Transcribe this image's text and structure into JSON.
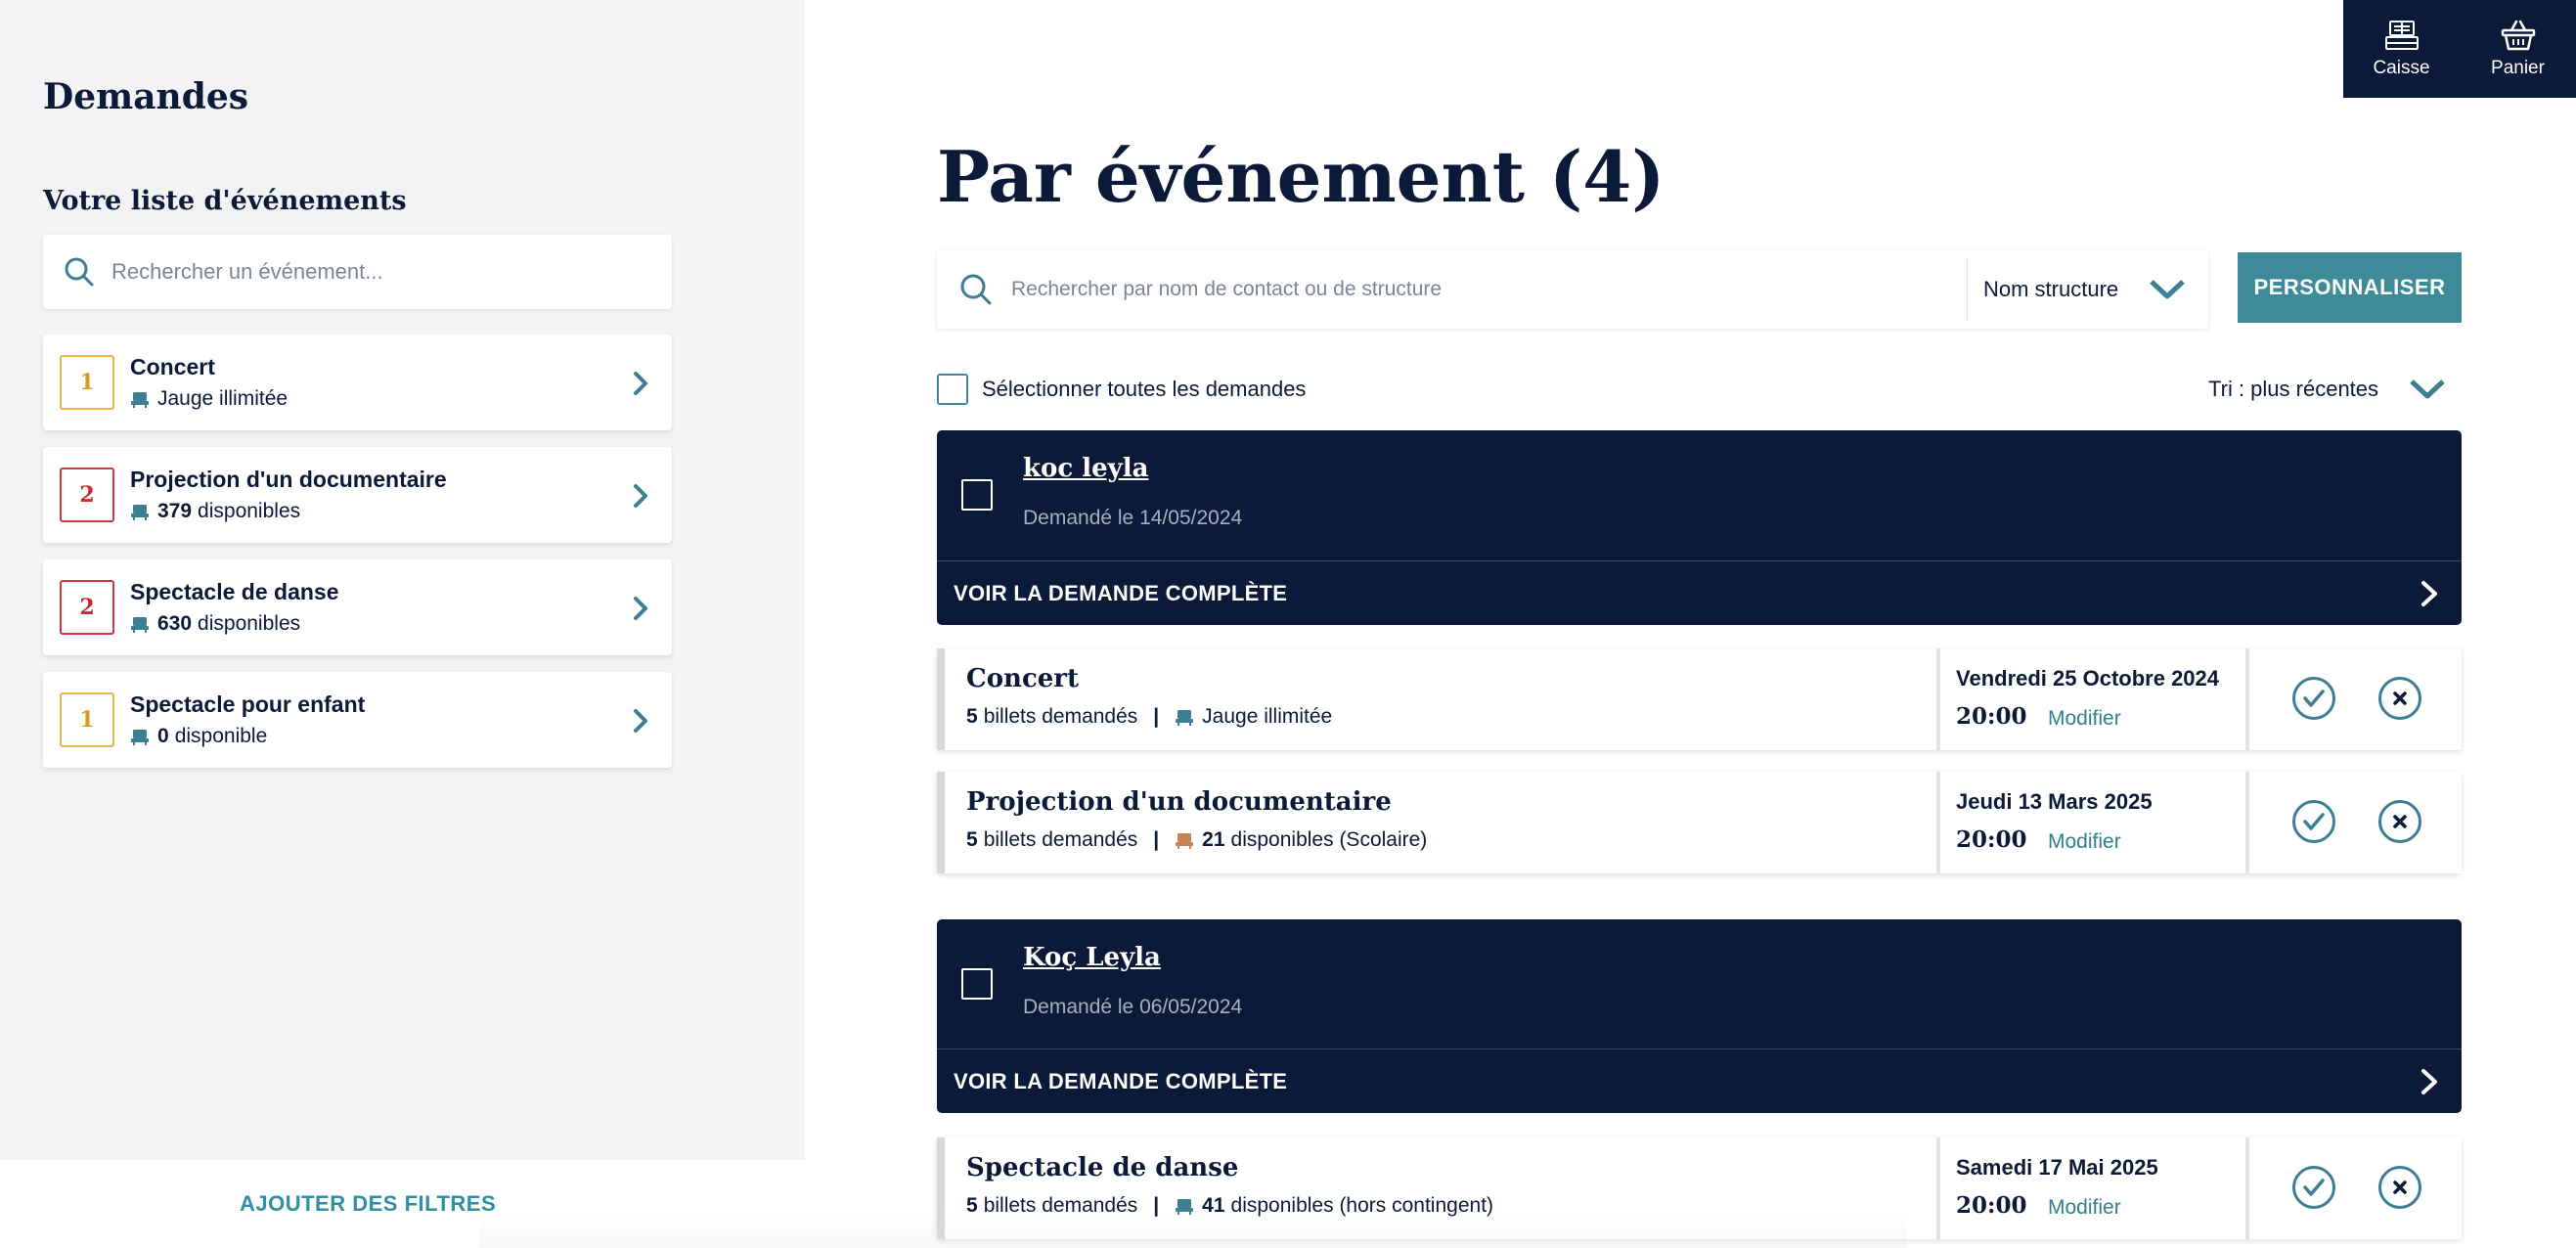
{
  "sidebar": {
    "title": "Demandes",
    "subtitle": "Votre liste d'événements",
    "search_placeholder": "Rechercher un événement...",
    "events": [
      {
        "count": "1",
        "name": "Concert",
        "cap_num": "",
        "cap_text": "Jauge illimitée",
        "badge": "yellow"
      },
      {
        "count": "2",
        "name": "Projection d'un documentaire",
        "cap_num": "379",
        "cap_text": "disponibles",
        "badge": "red"
      },
      {
        "count": "2",
        "name": "Spectacle de danse",
        "cap_num": "630",
        "cap_text": "disponibles",
        "badge": "red"
      },
      {
        "count": "1",
        "name": "Spectacle pour enfant",
        "cap_num": "0",
        "cap_text": "disponible",
        "badge": "yellow"
      }
    ],
    "footer_label": "AJOUTER DES FILTRES"
  },
  "topnav": {
    "caisse_label": "Caisse",
    "panier_label": "Panier"
  },
  "main": {
    "title": "Par événement (4)",
    "search_placeholder": "Rechercher par nom de contact ou de structure",
    "search_filter": "Nom structure",
    "customize_label": "PERSONNALISER",
    "select_all_label": "Sélectionner toutes les demandes",
    "sort_label": "Tri : plus récentes",
    "requests": [
      {
        "name": "koc leyla",
        "date": "Demandé le 14/05/2024",
        "link_label": "VOIR LA DEMANDE COMPLÈTE",
        "items": [
          {
            "event": "Concert",
            "tickets_num": "5",
            "tickets_text": "billets demandés",
            "cap_num": "",
            "cap_text": "Jauge illimitée",
            "seat_color": "#3d7e93",
            "date": "Vendredi 25 Octobre 2024",
            "time": "20:00",
            "modify": "Modifier"
          },
          {
            "event": "Projection d'un documentaire",
            "tickets_num": "5",
            "tickets_text": "billets demandés",
            "cap_num": "21",
            "cap_text": "disponibles (Scolaire)",
            "seat_color": "#c7835a",
            "date": "Jeudi 13 Mars 2025",
            "time": "20:00",
            "modify": "Modifier"
          }
        ]
      },
      {
        "name": "Koç Leyla",
        "date": "Demandé le 06/05/2024",
        "link_label": "VOIR LA DEMANDE COMPLÈTE",
        "items": [
          {
            "event": "Spectacle de danse",
            "tickets_num": "5",
            "tickets_text": "billets demandés",
            "cap_num": "41",
            "cap_text": "disponibles (hors contingent)",
            "seat_color": "#3d7e93",
            "date": "Samedi 17 Mai 2025",
            "time": "20:00",
            "modify": "Modifier"
          }
        ]
      }
    ]
  },
  "colors": {
    "navy": "#0b1a38",
    "teal": "#3d8a98",
    "badge_yellow": "#e8b44a",
    "badge_red": "#d3373b"
  }
}
